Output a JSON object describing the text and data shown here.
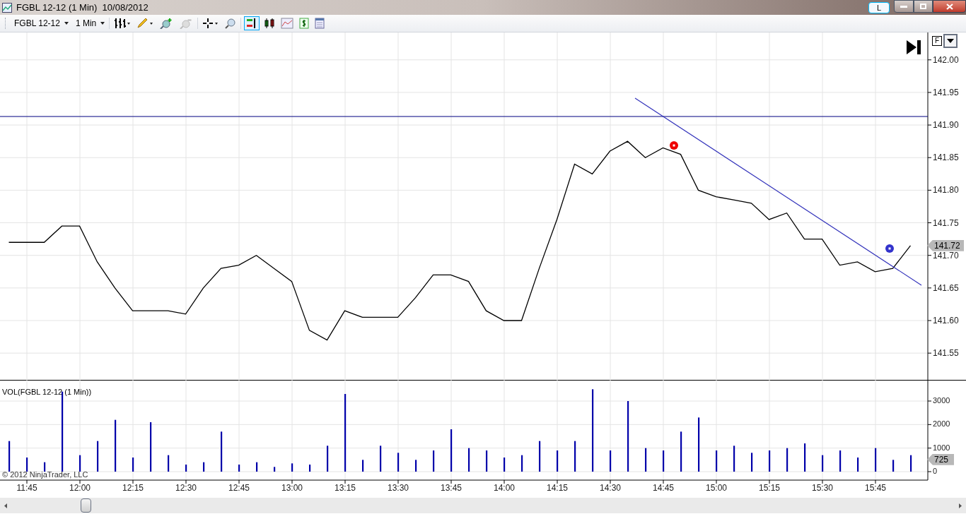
{
  "window": {
    "title": "FGBL 12-12 (1 Min)  10/08/2012",
    "mode_button": "L"
  },
  "toolbar": {
    "instrument": "FGBL 12-12",
    "interval": "1 Min"
  },
  "price_panel": {
    "format_button": "F",
    "last_price_label": "141.72",
    "chart_data": {
      "type": "line",
      "grid": true,
      "categories": [
        null,
        null,
        null,
        null,
        null,
        null,
        null,
        null,
        null,
        null,
        null,
        null,
        null,
        null,
        null,
        null,
        null,
        null,
        null,
        null,
        null,
        null,
        null,
        null,
        null,
        null,
        null,
        null,
        null,
        null,
        null,
        null,
        null,
        null,
        null,
        null,
        null,
        null,
        null,
        null,
        null,
        null,
        null,
        null,
        null,
        null,
        null,
        null,
        null,
        null,
        null,
        null
      ],
      "series": [
        {
          "color": "#000000",
          "values": [
            141.72,
            141.72,
            141.72,
            141.745,
            141.745,
            141.69,
            141.65,
            141.615,
            141.615,
            141.615,
            141.61,
            141.65,
            141.68,
            141.685,
            141.7,
            141.68,
            141.66,
            141.585,
            141.57,
            141.615,
            141.605,
            141.605,
            141.605,
            141.635,
            141.67,
            141.67,
            141.66,
            141.615,
            141.6,
            141.6,
            141.68,
            141.755,
            141.84,
            141.825,
            141.86,
            141.875,
            141.85,
            141.865,
            141.855,
            141.8,
            141.79,
            141.785,
            141.78,
            141.755,
            141.765,
            141.725,
            141.725,
            141.685,
            141.69,
            141.675,
            141.68,
            141.715
          ]
        }
      ],
      "ylim": [
        141.509,
        142.042
      ],
      "yticks": [
        {
          "value": 142.0,
          "label": "142.00"
        },
        {
          "value": 141.95,
          "label": "141.95"
        },
        {
          "value": 141.9,
          "label": "141.90"
        },
        {
          "value": 141.85,
          "label": "141.85"
        },
        {
          "value": 141.8,
          "label": "141.80"
        },
        {
          "value": 141.75,
          "label": "141.75"
        },
        {
          "value": 141.7,
          "label": "141.70"
        },
        {
          "value": 141.65,
          "label": "141.65"
        },
        {
          "value": 141.6,
          "label": "141.60"
        },
        {
          "value": 141.55,
          "label": "141.55"
        }
      ]
    }
  },
  "volume_panel": {
    "last_volume_label": "725",
    "chart_data": {
      "type": "bar",
      "title": "VOL(FGBL 12-12 (1 Min))",
      "grid": true,
      "x": [
        700,
        705,
        710,
        715,
        720,
        725,
        730,
        735,
        740,
        745,
        750,
        755,
        760,
        765,
        770,
        775,
        780,
        785,
        790,
        795,
        800,
        805,
        810,
        815,
        820,
        825,
        830,
        835,
        840,
        845,
        850,
        855,
        860,
        865,
        870,
        875,
        880,
        885,
        890,
        895,
        900,
        905,
        910,
        915,
        920,
        925,
        930,
        935,
        940,
        945,
        950,
        955
      ],
      "series": [
        {
          "color": "#0000aa",
          "values": [
            1300,
            600,
            400,
            3400,
            700,
            1300,
            2200,
            600,
            2100,
            700,
            300,
            400,
            1700,
            300,
            400,
            200,
            350,
            300,
            1100,
            3300,
            500,
            1100,
            800,
            500,
            900,
            1800,
            1000,
            900,
            600,
            700,
            1300,
            900,
            1300,
            3500,
            900,
            3000,
            1000,
            900,
            1700,
            2300,
            900,
            1100,
            800,
            900,
            1000,
            1200,
            700,
            900,
            600,
            1000,
            500,
            700
          ]
        }
      ],
      "xlim": [
        697.4,
        959.8
      ],
      "ylim": [
        -360,
        3900
      ],
      "yticks": [
        0,
        1000,
        2000,
        3000
      ],
      "xticks": [
        {
          "value": 705,
          "label": "11:45"
        },
        {
          "value": 720,
          "label": "12:00"
        },
        {
          "value": 735,
          "label": "12:15"
        },
        {
          "value": 750,
          "label": "12:30"
        },
        {
          "value": 765,
          "label": "12:45"
        },
        {
          "value": 780,
          "label": "13:00"
        },
        {
          "value": 795,
          "label": "13:15"
        },
        {
          "value": 810,
          "label": "13:30"
        },
        {
          "value": 825,
          "label": "13:45"
        },
        {
          "value": 840,
          "label": "14:00"
        },
        {
          "value": 855,
          "label": "14:15"
        },
        {
          "value": 870,
          "label": "14:30"
        },
        {
          "value": 885,
          "label": "14:45"
        },
        {
          "value": 900,
          "label": "15:00"
        },
        {
          "value": 915,
          "label": "15:15"
        },
        {
          "value": 930,
          "label": "15:30"
        },
        {
          "value": 945,
          "label": "15:45"
        }
      ]
    }
  },
  "copyright": "© 2012 NinjaTrader, LLC"
}
